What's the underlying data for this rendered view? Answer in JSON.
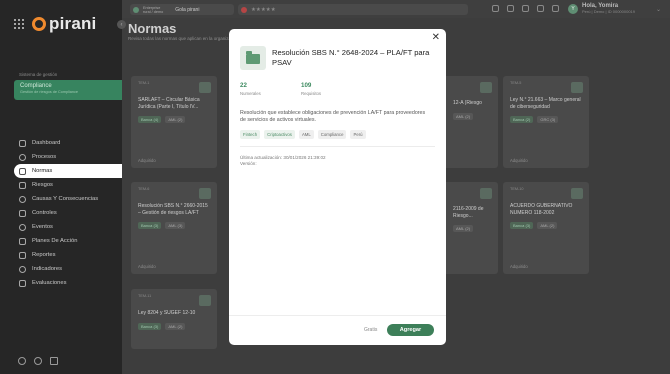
{
  "brand": {
    "logo_text": "pirani"
  },
  "system": {
    "label": "Sistema de gestión",
    "name": "Compliance",
    "subtitle": "Gestión de riesgos de Compliance"
  },
  "nav": {
    "items": [
      {
        "label": "Dashboard",
        "icon": "monitor-icon"
      },
      {
        "label": "Procesos",
        "icon": "flow-icon"
      },
      {
        "label": "Normas",
        "icon": "book-icon",
        "active": true
      },
      {
        "label": "Riesgos",
        "icon": "warning-icon"
      },
      {
        "label": "Causas Y Consecuencias",
        "icon": "cause-icon"
      },
      {
        "label": "Controles",
        "icon": "shield-icon"
      },
      {
        "label": "Eventos",
        "icon": "event-icon"
      },
      {
        "label": "Planes De Acción",
        "icon": "plan-icon"
      },
      {
        "label": "Reportes",
        "icon": "report-icon"
      },
      {
        "label": "Indicadores",
        "icon": "indicator-icon"
      },
      {
        "label": "Evaluaciones",
        "icon": "evaluation-icon"
      }
    ]
  },
  "topbar": {
    "company_line1": "Enterprise",
    "company_line2": "rural / demo",
    "company_select": "Gola pirani",
    "rating_text": "★★★★★",
    "user_greeting": "Hola, Yomira",
    "user_sub": "Perú | Demo | ID 0000000019",
    "avatar": "Y"
  },
  "page": {
    "title": "Normas",
    "subtitle": "Revisa todas las normas que aplican en la organización"
  },
  "cards": [
    {
      "tag": "TEM-1",
      "title": "SARLAFT – Circular Básica Jurídica (Parte I, Título IV...",
      "chips": [
        "Banca (4)",
        "AML (2)"
      ],
      "foot": "Adquirido"
    },
    {
      "tag": "TEM-6",
      "title": "Resolución SBS N.° 2660-2015 – Gestión de riesgos LA/FT",
      "chips": [
        "Banca (3)",
        "AML (3)"
      ],
      "foot": "Adquirido"
    },
    {
      "tag": "TEM-11",
      "title": "Ley 8204 y SUGEF 12-10",
      "chips": [
        "Banca (3)",
        "AML (2)"
      ],
      "foot": ""
    },
    {
      "tag": "",
      "title": "12-A (Riesgo",
      "chips": [
        "AML (2)"
      ],
      "foot": ""
    },
    {
      "tag": "",
      "title": "2116-2009 de Riesgo...",
      "chips": [
        "AML (2)"
      ],
      "foot": ""
    },
    {
      "tag": "TEM-5",
      "title": "Ley N.° 21.663 – Marco general de ciberseguridad",
      "chips": [
        "Banca (2)",
        "GRC (3)"
      ],
      "foot": "Adquirido"
    },
    {
      "tag": "TEM-10",
      "title": "ACUERDO GUBERNATIVO NUMERO 118-2002",
      "chips": [
        "Banca (3)",
        "AML (2)"
      ],
      "foot": "Adquirido"
    }
  ],
  "modal": {
    "title": "Resolución SBS N.° 2648-2024 – PLA/FT para PSAV",
    "stats": [
      {
        "value": "22",
        "label": "Numerales"
      },
      {
        "value": "109",
        "label": "Requisitos"
      }
    ],
    "description": "Resolución que establece obligaciones de prevención LA/FT para proveedores de servicios de activos virtuales.",
    "chips": [
      "Fintech",
      "Criptoactivos",
      "AML",
      "Compliance",
      "Perú"
    ],
    "updated": "Última actualización: 30/01/2026 21:39:02",
    "version": "Versión:",
    "back_label": "Gratis",
    "add_label": "Agregar",
    "colors": {
      "accent": "#3d7f59",
      "chip_bg": "#ebf2ed"
    }
  }
}
